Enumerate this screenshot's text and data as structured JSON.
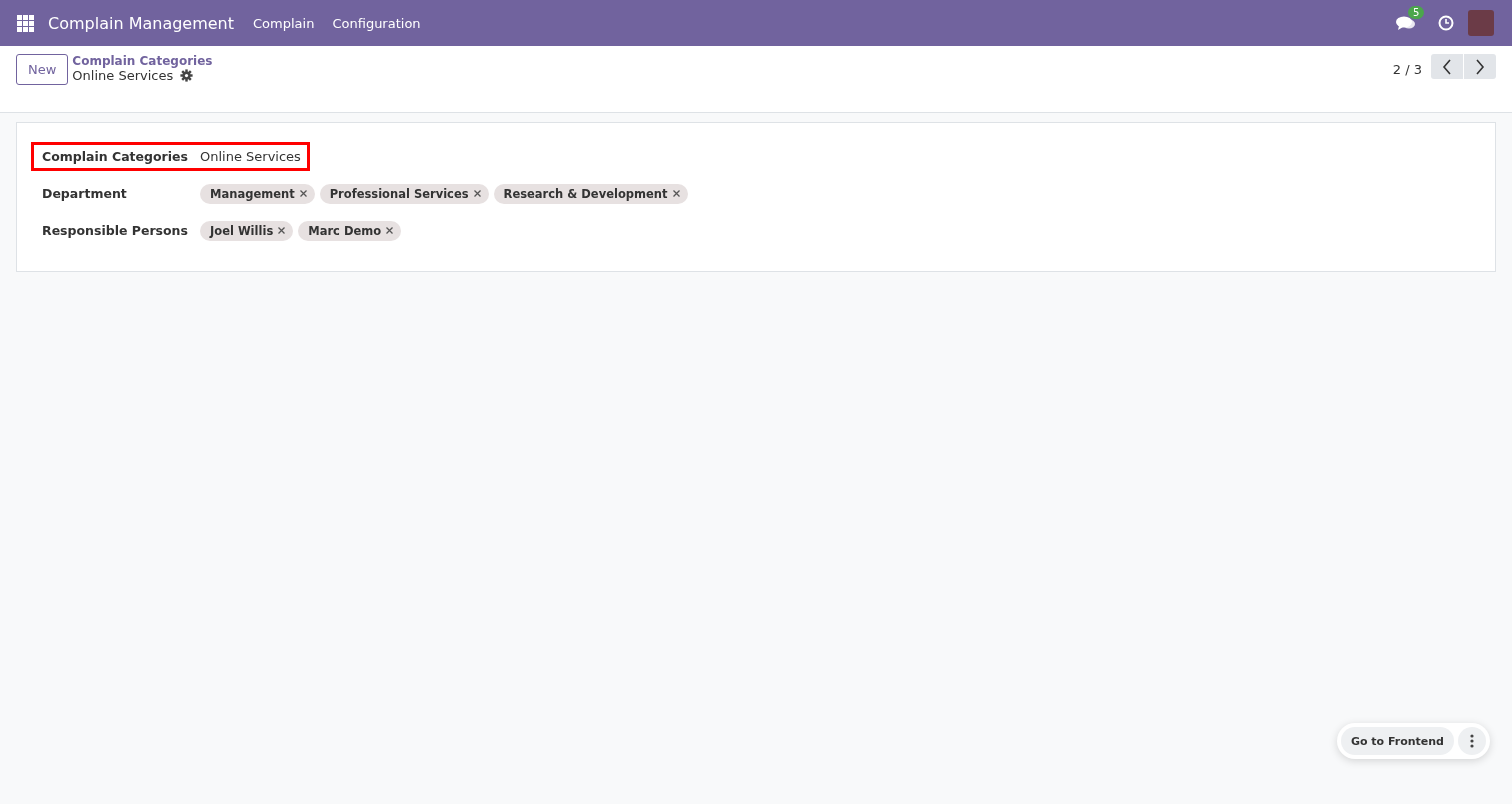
{
  "navbar": {
    "app_title": "Complain Management",
    "menus": [
      "Complain",
      "Configuration"
    ],
    "message_count": "5"
  },
  "control_panel": {
    "new_button": "New",
    "breadcrumb_parent": "Complain Categories",
    "record_title": "Online Services",
    "pager": "2 / 3"
  },
  "form": {
    "fields": [
      {
        "kind": "text",
        "label": "Complain Categories",
        "value": "Online Services",
        "highlighted": true
      },
      {
        "kind": "tags",
        "label": "Department",
        "tags": [
          "Management",
          "Professional Services",
          "Research & Development"
        ],
        "highlighted": false
      },
      {
        "kind": "tags",
        "label": "Responsible Persons",
        "tags": [
          "Joel Willis",
          "Marc Demo"
        ],
        "highlighted": false
      }
    ]
  },
  "floating_actions": {
    "button": "Go to Frontend"
  }
}
